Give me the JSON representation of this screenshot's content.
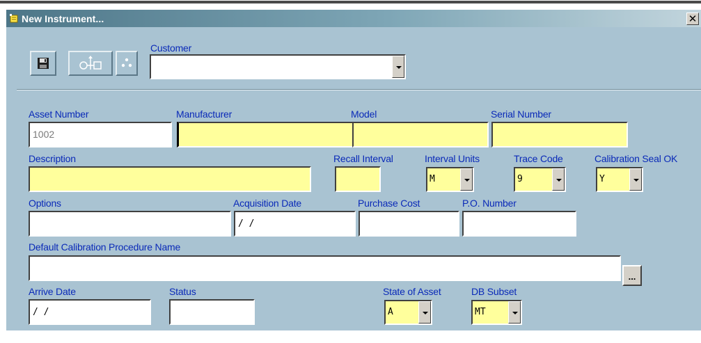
{
  "window": {
    "title": "New Instrument...",
    "close_glyph": "✕"
  },
  "toolbar": {
    "buttons": [
      {
        "name": "save-button",
        "icon": "floppy-disk-icon"
      },
      {
        "name": "instrument-link-button",
        "icon": "link-arrows-icon"
      },
      {
        "name": "dots-button",
        "icon": "dots-icon"
      }
    ]
  },
  "labels": {
    "customer": "Customer",
    "asset_number": "Asset Number",
    "manufacturer": "Manufacturer",
    "model": "Model",
    "serial_number": "Serial Number",
    "description": "Description",
    "recall_interval": "Recall Interval",
    "interval_units": "Interval Units",
    "trace_code": "Trace Code",
    "calibration_seal_ok": "Calibration Seal OK",
    "options": "Options",
    "acquisition_date": "Acquisition Date",
    "purchase_cost": "Purchase Cost",
    "po_number": "P.O. Number",
    "default_calibration_procedure_name": "Default Calibration Procedure Name",
    "arrive_date": "Arrive Date",
    "status": "Status",
    "state_of_asset": "State of Asset",
    "db_subset": "DB Subset"
  },
  "values": {
    "customer": "",
    "asset_number": "1002",
    "manufacturer": "",
    "model": "",
    "serial_number": "",
    "description": "",
    "recall_interval": "",
    "interval_units": "M",
    "trace_code": "9",
    "calibration_seal_ok": "Y",
    "options": "",
    "acquisition_date": " / /",
    "purchase_cost": "",
    "po_number": "",
    "default_calibration_procedure_name": "",
    "arrive_date": " / /",
    "status": "",
    "state_of_asset": "A",
    "db_subset": "MT"
  },
  "browse_label": "...",
  "colors": {
    "window_bg": "#a9c3d2",
    "label_blue": "#0a2ab8",
    "required_yellow": "#ffff9c",
    "title_start": "#4d7688",
    "title_end": "#c2d5dd"
  }
}
